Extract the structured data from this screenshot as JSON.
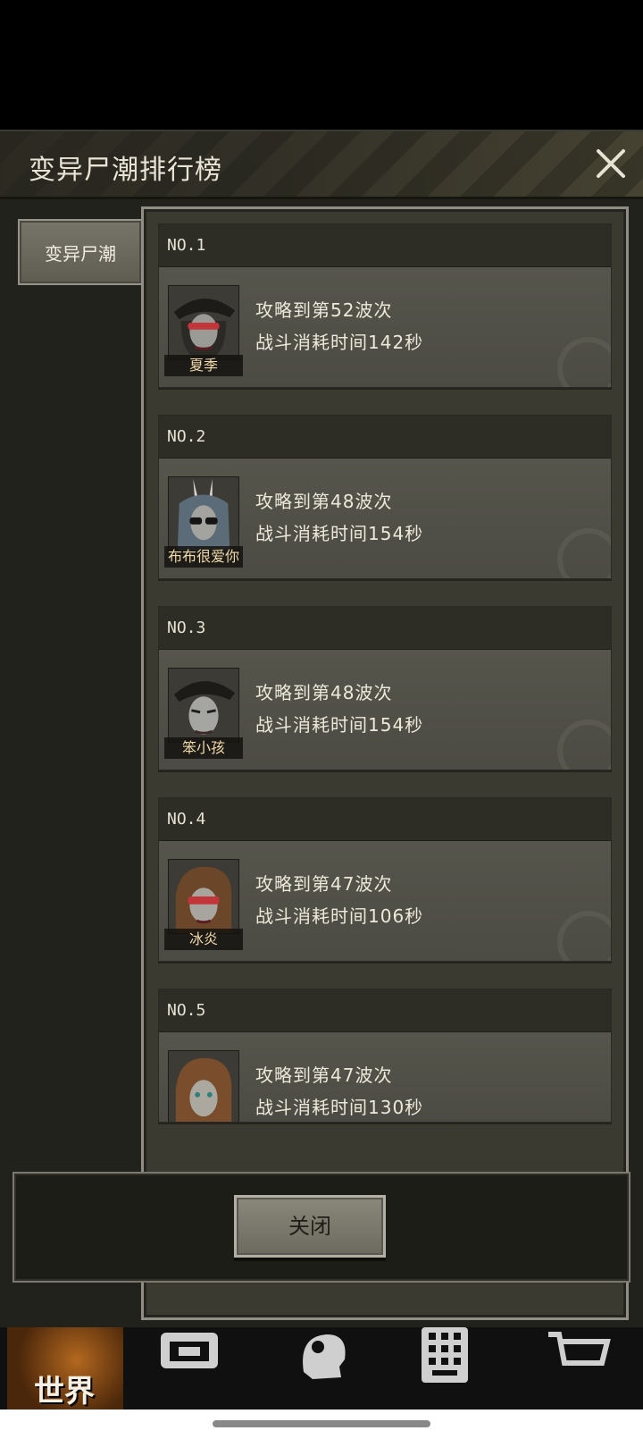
{
  "header": {
    "title": "变异尸潮排行榜"
  },
  "tabs": [
    {
      "label": "变异尸潮",
      "active": true
    }
  ],
  "ranks": [
    {
      "rank": "NO.1",
      "name": "夏季",
      "wave": "攻略到第52波次",
      "time": "战斗消耗时间142秒",
      "avatar": "avatar-pirate-hat-red-goggles"
    },
    {
      "rank": "NO.2",
      "name": "布布很爱你",
      "wave": "攻略到第48波次",
      "time": "战斗消耗时间154秒",
      "avatar": "avatar-bunny-ears-sunglasses"
    },
    {
      "rank": "NO.3",
      "name": "笨小孩",
      "wave": "攻略到第48波次",
      "time": "战斗消耗时间154秒",
      "avatar": "avatar-pirate-hat-male"
    },
    {
      "rank": "NO.4",
      "name": "冰炎",
      "wave": "攻略到第47波次",
      "time": "战斗消耗时间106秒",
      "avatar": "avatar-brown-hair-red-goggles"
    },
    {
      "rank": "NO.5",
      "name": "",
      "wave": "攻略到第47波次",
      "time": "战斗消耗时间130秒",
      "avatar": "avatar-brown-hair-female"
    }
  ],
  "footer": {
    "close_label": "关闭"
  },
  "bottom_nav": {
    "world_label": "世界"
  },
  "colors": {
    "panel_bg": "#22221c",
    "card_bg": "#4a4941",
    "header_bg": "#2d2c25",
    "name_color": "#f0d8a8",
    "world_tab": "#b3681f"
  }
}
